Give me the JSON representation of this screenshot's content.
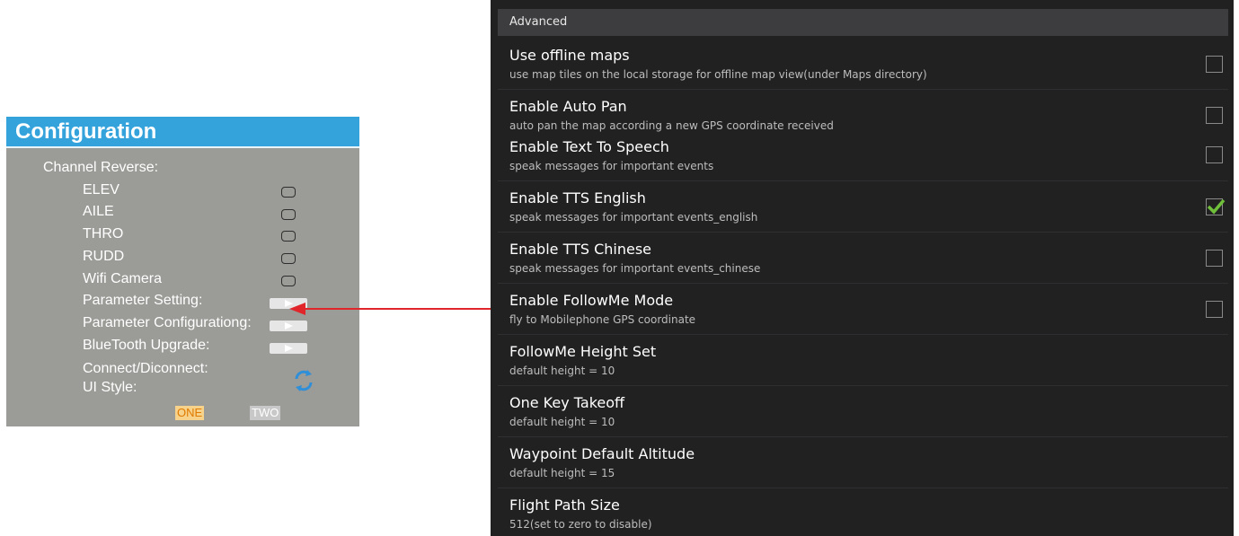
{
  "config": {
    "title": "Configuration",
    "channel_reverse_label": "Channel Reverse:",
    "channels": [
      "ELEV",
      "AILE",
      "THRO",
      "RUDD",
      "Wifi Camera"
    ],
    "parameter_setting_label": "Parameter Setting:",
    "parameter_configurating_label": "Parameter Configurationg:",
    "bluetooth_upgrade_label": "BlueTooth Upgrade:",
    "connect_label": "Connect/Diconnect:",
    "ui_style_label": "UI Style:",
    "ui_style_one": "ONE",
    "ui_style_two": "TWO"
  },
  "settings": {
    "section_header": "Advanced",
    "items": [
      {
        "title": "Use offline maps",
        "subtitle": "use map tiles on the local storage for offline map view(under Maps directory)",
        "checked": false
      },
      {
        "title": "Enable Auto Pan",
        "subtitle": "auto pan the map according a new GPS coordinate received",
        "checked": false
      },
      {
        "title": "Enable Text To Speech",
        "subtitle": "speak messages for important events",
        "checked": false
      },
      {
        "title": "Enable TTS English",
        "subtitle": "speak messages for important events_english",
        "checked": true
      },
      {
        "title": "Enable TTS Chinese",
        "subtitle": "speak messages for important events_chinese",
        "checked": false
      },
      {
        "title": "Enable FollowMe Mode",
        "subtitle": "fly to Mobilephone GPS coordinate",
        "checked": false
      },
      {
        "title": "FollowMe Height Set",
        "subtitle": "default height = 10"
      },
      {
        "title": "One Key Takeoff",
        "subtitle": "default height = 10"
      },
      {
        "title": "Waypoint Default Altitude",
        "subtitle": "default height = 15"
      },
      {
        "title": "Flight Path Size",
        "subtitle": "512(set to zero to disable)"
      }
    ]
  },
  "colors": {
    "config_header": "#34a3dc",
    "config_bg": "#9b9b97",
    "settings_bg": "#212122",
    "check_mark": "#6fbf3a",
    "arrow": "#e0262b"
  }
}
